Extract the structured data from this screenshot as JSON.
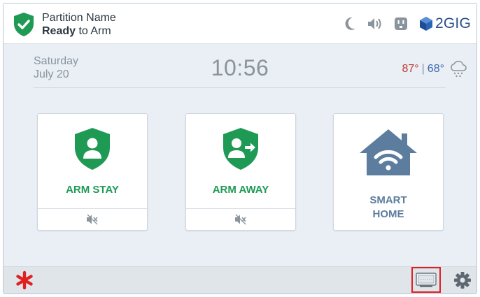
{
  "header": {
    "partition_name": "Partition Name",
    "status_bold": "Ready",
    "status_rest": " to Arm",
    "icons": [
      "shield-check-icon",
      "moon-icon",
      "speaker-icon",
      "outlet-icon"
    ],
    "brand": "2GIG",
    "brand_icon": "cube-icon"
  },
  "info": {
    "day": "Saturday",
    "date": "July 20",
    "time": "10:56",
    "temp_high": "87°",
    "temp_sep": "|",
    "temp_low": "68°",
    "weather_icon": "snow-cloud-icon"
  },
  "tiles": [
    {
      "label": "ARM STAY",
      "icon": "person-shield-icon",
      "sub_icon": "mute-icon"
    },
    {
      "label": "ARM AWAY",
      "icon": "person-leave-shield-icon",
      "sub_icon": "mute-icon"
    },
    {
      "label_line1": "SMART",
      "label_line2": "HOME",
      "icon": "smart-home-wifi-icon"
    }
  ],
  "footer": {
    "emergency_icon": "asterisk-icon",
    "keypad_icon": "keypad-screen-icon",
    "settings_icon": "gear-icon"
  },
  "colors": {
    "green": "#1f9a55",
    "slate": "#5d7d9f",
    "hot": "#c0392f",
    "cold": "#3e67b0",
    "alert": "#e02020"
  }
}
